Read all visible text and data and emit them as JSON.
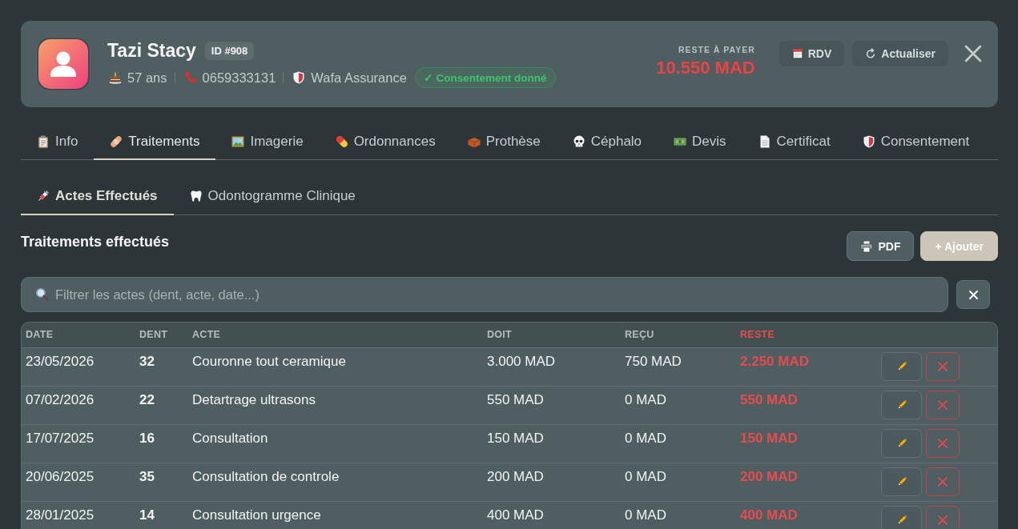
{
  "patient": {
    "name": "Tazi Stacy",
    "id_badge": "ID #908",
    "age": "57 ans",
    "phone": "0659333131",
    "insurance": "Wafa Assurance",
    "consent_badge": "✓ Consentement donné"
  },
  "balance": {
    "label": "RESTE À PAYER",
    "amount": "10.550 MAD"
  },
  "header_buttons": [
    {
      "label": "RDV"
    },
    {
      "label": "Actualiser"
    }
  ],
  "tabs": [
    {
      "label": "Info",
      "selected": false
    },
    {
      "label": "Traitements",
      "selected": true
    },
    {
      "label": "Imagerie",
      "selected": false
    },
    {
      "label": "Ordonnances",
      "selected": false
    },
    {
      "label": "Prothèse",
      "selected": false
    },
    {
      "label": "Céphalo",
      "selected": false
    },
    {
      "label": "Devis",
      "selected": false
    },
    {
      "label": "Certificat",
      "selected": false
    },
    {
      "label": "Consentement",
      "selected": false
    }
  ],
  "subtabs": [
    {
      "label": "Actes Effectués",
      "selected": true
    },
    {
      "label": "Odontogramme Clinique",
      "selected": false
    }
  ],
  "section": {
    "title": "Traitements effectués",
    "buttons": [
      {
        "label": "PDF",
        "kind": "secondary"
      },
      {
        "label": "+ Ajouter",
        "kind": "primary"
      }
    ]
  },
  "filter": {
    "placeholder": "Filtrer les actes (dent, acte, date...)"
  },
  "table": {
    "columns": [
      "DATE",
      "DENT",
      "ACTE",
      "DOIT",
      "REÇU",
      "RESTE"
    ],
    "rows": [
      {
        "date": "23/05/2026",
        "tooth": "32",
        "act": "Couronne tout ceramique",
        "due": "3.000 MAD",
        "received": "750 MAD",
        "remaining": "2.250 MAD"
      },
      {
        "date": "07/02/2026",
        "tooth": "22",
        "act": "Detartrage ultrasons",
        "due": "550 MAD",
        "received": "0 MAD",
        "remaining": "550 MAD"
      },
      {
        "date": "17/07/2025",
        "tooth": "16",
        "act": "Consultation",
        "due": "150 MAD",
        "received": "0 MAD",
        "remaining": "150 MAD"
      },
      {
        "date": "20/06/2025",
        "tooth": "35",
        "act": "Consultation de controle",
        "due": "200 MAD",
        "received": "0 MAD",
        "remaining": "200 MAD"
      },
      {
        "date": "28/01/2025",
        "tooth": "14",
        "act": "Consultation urgence",
        "due": "400 MAD",
        "received": "0 MAD",
        "remaining": "400 MAD"
      }
    ]
  }
}
